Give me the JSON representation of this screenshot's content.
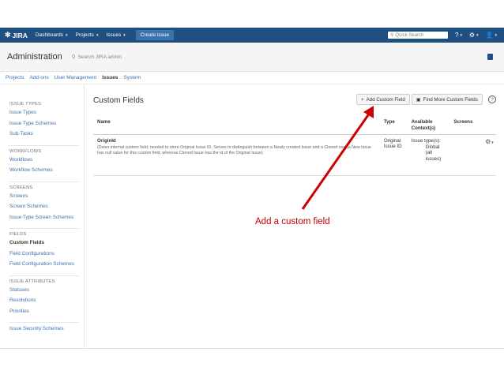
{
  "topnav": {
    "logo": "JIRA",
    "items": [
      "Dashboards",
      "Projects",
      "Issues"
    ],
    "create_label": "Create issue",
    "search_placeholder": "Quick Search"
  },
  "admin": {
    "title": "Administration",
    "search_placeholder": "Search JIRA admin"
  },
  "admin_tabs": [
    "Projects",
    "Add-ons",
    "User Management",
    "Issues",
    "System"
  ],
  "active_admin_tab": "Issues",
  "sidebar": {
    "sections": [
      {
        "heading": "ISSUE TYPES",
        "links": [
          "Issue Types",
          "Issue Type Schemes",
          "Sub-Tasks"
        ]
      },
      {
        "heading": "WORKFLOWS",
        "links": [
          "Workflows",
          "Workflow Schemes"
        ]
      },
      {
        "heading": "SCREENS",
        "links": [
          "Screens",
          "Screen Schemes",
          "Issue Type Screen Schemes"
        ]
      },
      {
        "heading": "FIELDS",
        "links": [
          "Custom Fields",
          "Field Configurations",
          "Field Configuration Schemes"
        ]
      },
      {
        "heading": "ISSUE ATTRIBUTES",
        "links": [
          "Statuses",
          "Resolutions",
          "Priorities"
        ]
      },
      {
        "heading": "",
        "links": [
          "Issue Security Schemes"
        ]
      }
    ],
    "active_link": "Custom Fields"
  },
  "main": {
    "title": "Custom Fields",
    "add_button": "Add Custom Field",
    "find_button": "Find More Custom Fields",
    "columns": [
      "Name",
      "Type",
      "Available Context(s)",
      "Screens"
    ],
    "rows": [
      {
        "name": "OriginId",
        "description": "(Deiso internal custom field, needed to store Original Issue ID. Serves to distinguish between a Newly created Issue and a Cloned one (a New Issue has null value for this custom field, whereas Cloned Issue has the id of the Original Issue).",
        "type": "Original Issue ID",
        "context_lines": [
          "Issue type(s):",
          "Global",
          "(all",
          "issues)"
        ],
        "screens": ""
      }
    ]
  },
  "annotation": {
    "text": "Add a custom field",
    "color": "#cc0000"
  },
  "colors": {
    "nav_bg": "#205081",
    "link": "#3b73af",
    "create_btn": "#3b73af"
  }
}
